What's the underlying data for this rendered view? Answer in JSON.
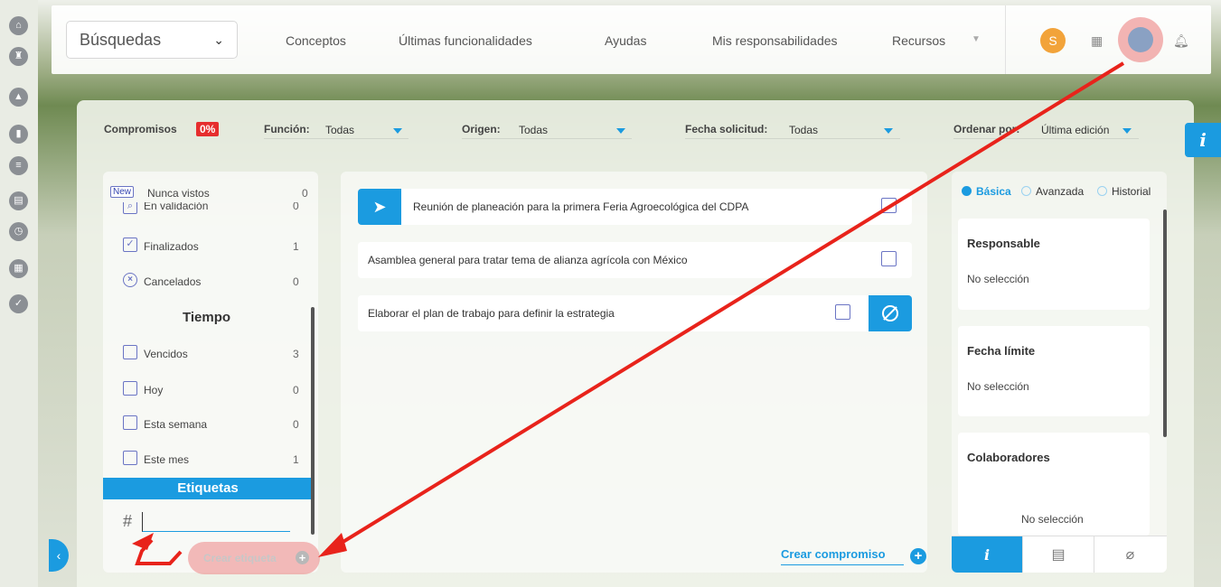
{
  "topbar": {
    "search_select": "Búsquedas",
    "nav": [
      "Conceptos",
      "Últimas funcionalidades",
      "Ayudas",
      "Mis responsabilidades",
      "Recursos"
    ],
    "avatar_initial": "S"
  },
  "filters": {
    "compromisos_label": "Compromisos",
    "compromisos_badge": "0%",
    "funcion_label": "Función:",
    "funcion_value": "Todas",
    "origen_label": "Origen:",
    "origen_value": "Todas",
    "fecha_label": "Fecha solicitud:",
    "fecha_value": "Todas",
    "ordenar_label": "Ordenar por:",
    "ordenar_value": "Última edición"
  },
  "left_panel": {
    "new_tag": "New",
    "items": [
      {
        "label": "Nunca vistos",
        "count": "0"
      },
      {
        "label": "En validación",
        "count": "0"
      },
      {
        "label": "Finalizados",
        "count": "1"
      },
      {
        "label": "Cancelados",
        "count": "0"
      }
    ],
    "tiempo_heading": "Tiempo",
    "tiempo_items": [
      {
        "label": "Vencidos",
        "count": "3"
      },
      {
        "label": "Hoy",
        "count": "0"
      },
      {
        "label": "Esta semana",
        "count": "0"
      },
      {
        "label": "Este mes",
        "count": "1"
      }
    ],
    "etiquetas_heading": "Etiquetas",
    "hash": "#",
    "tag_input_value": "",
    "create_tag_label": "Crear etiqueta"
  },
  "tasks": [
    "Reunión de planeación para la primera Feria Agroecológica del CDPA",
    "Asamblea general para tratar tema de alianza agrícola con México",
    "Elaborar el plan de trabajo para definir la estrategia"
  ],
  "create_commitment_label": "Crear compromiso",
  "right_panel": {
    "radios": [
      "Básica",
      "Avanzada",
      "Historial"
    ],
    "selected_radio": "Básica",
    "cards": [
      {
        "title": "Responsable",
        "value": "No selección"
      },
      {
        "title": "Fecha límite",
        "value": "No selección"
      },
      {
        "title": "Colaboradores",
        "value": "No selección"
      }
    ]
  },
  "info_tab": "i",
  "colors": {
    "accent": "#1b9be0",
    "badge": "#e62e2e",
    "annotation": "#e8231b"
  }
}
